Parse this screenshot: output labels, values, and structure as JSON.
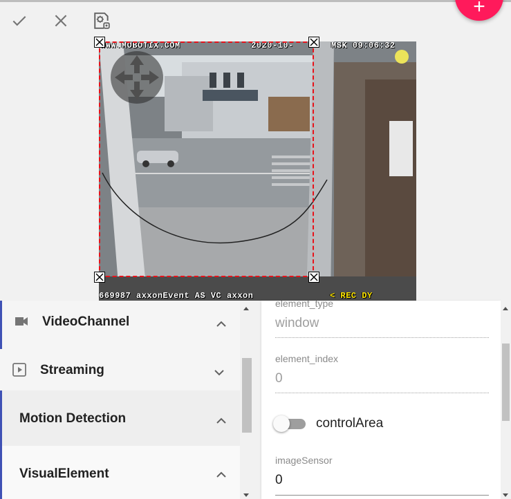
{
  "toolbar": {
    "apply_icon": "check-icon",
    "cancel_icon": "close-icon",
    "settings_icon": "gear-document-icon",
    "fab_icon": "plus-icon"
  },
  "video": {
    "osd_top_left": "WWW.MOBOTIX.COM",
    "osd_top_right": "2020-10-",
    "osd_top_tz": "MSK 09:06:32",
    "osd_bottom_left": "669987 axxonEvent AS VC axxon",
    "osd_bottom_rec": "< REC DY"
  },
  "accordion": [
    {
      "label": "VideoChannel",
      "icon": "video-camera-icon",
      "expanded": true
    },
    {
      "label": "Streaming",
      "icon": "play-square-icon",
      "expanded": false
    },
    {
      "label": "Motion Detection",
      "expanded": true
    },
    {
      "label": "VisualElement",
      "expanded": true
    }
  ],
  "form": {
    "element_type_label": "element_type",
    "element_type_value": "window",
    "element_index_label": "element_index",
    "element_index_value": "0",
    "control_area_label": "controlArea",
    "control_area_on": false,
    "image_sensor_label": "imageSensor",
    "image_sensor_value": "0"
  },
  "colors": {
    "accent": "#3f51b5",
    "fab": "#ff1a5b",
    "region_border": "#e8121a"
  }
}
